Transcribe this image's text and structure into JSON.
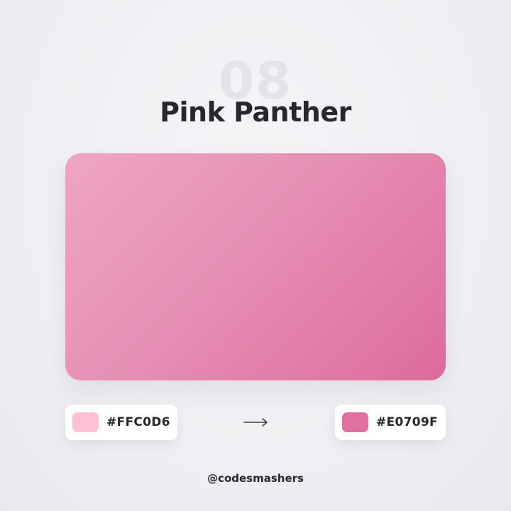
{
  "palette": {
    "number": "08",
    "title": "Pink Panther",
    "gradient": {
      "start_color": "#FFC0D6",
      "end_color": "#E0709F"
    },
    "from": {
      "hex": "#FFC0D6",
      "color": "#FFC0D6"
    },
    "to": {
      "hex": "#E0709F",
      "color": "#E0709F"
    },
    "arrow_icon": "arrow-right-icon"
  },
  "footer": {
    "handle": "@codesmashers"
  }
}
